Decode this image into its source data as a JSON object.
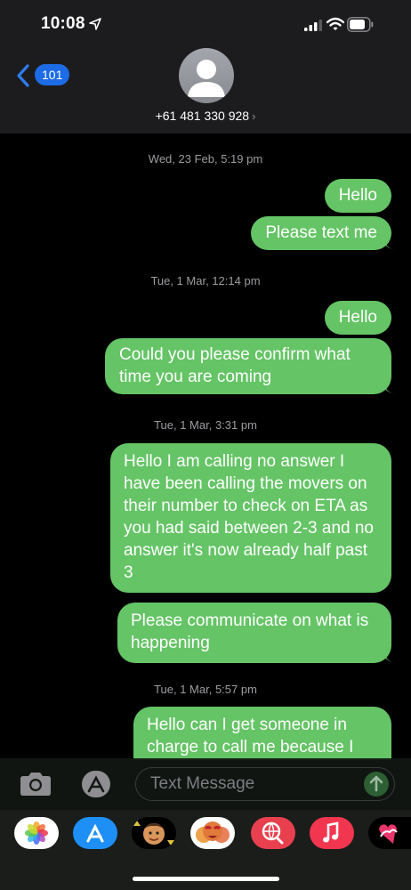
{
  "status_bar": {
    "time": "10:08"
  },
  "header": {
    "back_badge": "101",
    "contact": "+61 481 330 928",
    "chevron": "›"
  },
  "thread": [
    {
      "kind": "timestamp",
      "text": "Wed, 23 Feb, 5:19 pm"
    },
    {
      "kind": "message",
      "text": "Hello"
    },
    {
      "kind": "message",
      "text": "Please text me"
    },
    {
      "kind": "timestamp",
      "text": "Tue, 1 Mar, 12:14 pm"
    },
    {
      "kind": "message",
      "text": "Hello"
    },
    {
      "kind": "message",
      "text": "Could you please confirm what time you are coming"
    },
    {
      "kind": "timestamp",
      "text": "Tue, 1 Mar, 3:31 pm"
    },
    {
      "kind": "message",
      "text": "Hello I am calling no answer I have been calling the movers on their number to check on ETA as you had said between 2-3 and no answer it's now already half past 3"
    },
    {
      "kind": "message",
      "text": "Please communicate on what is happening"
    },
    {
      "kind": "timestamp",
      "text": "Tue, 1 Mar, 5:57 pm"
    },
    {
      "kind": "message",
      "text": "Hello can I get someone in charge to call me because I"
    }
  ],
  "composer": {
    "placeholder": "Text Message"
  },
  "app_tray": [
    "photos",
    "app-store",
    "memoji",
    "memoji-stickers",
    "images-search",
    "music",
    "digital-touch"
  ],
  "colors": {
    "bubble": "#65c466",
    "badge": "#1d6ce6",
    "back": "#2f7cf6"
  }
}
